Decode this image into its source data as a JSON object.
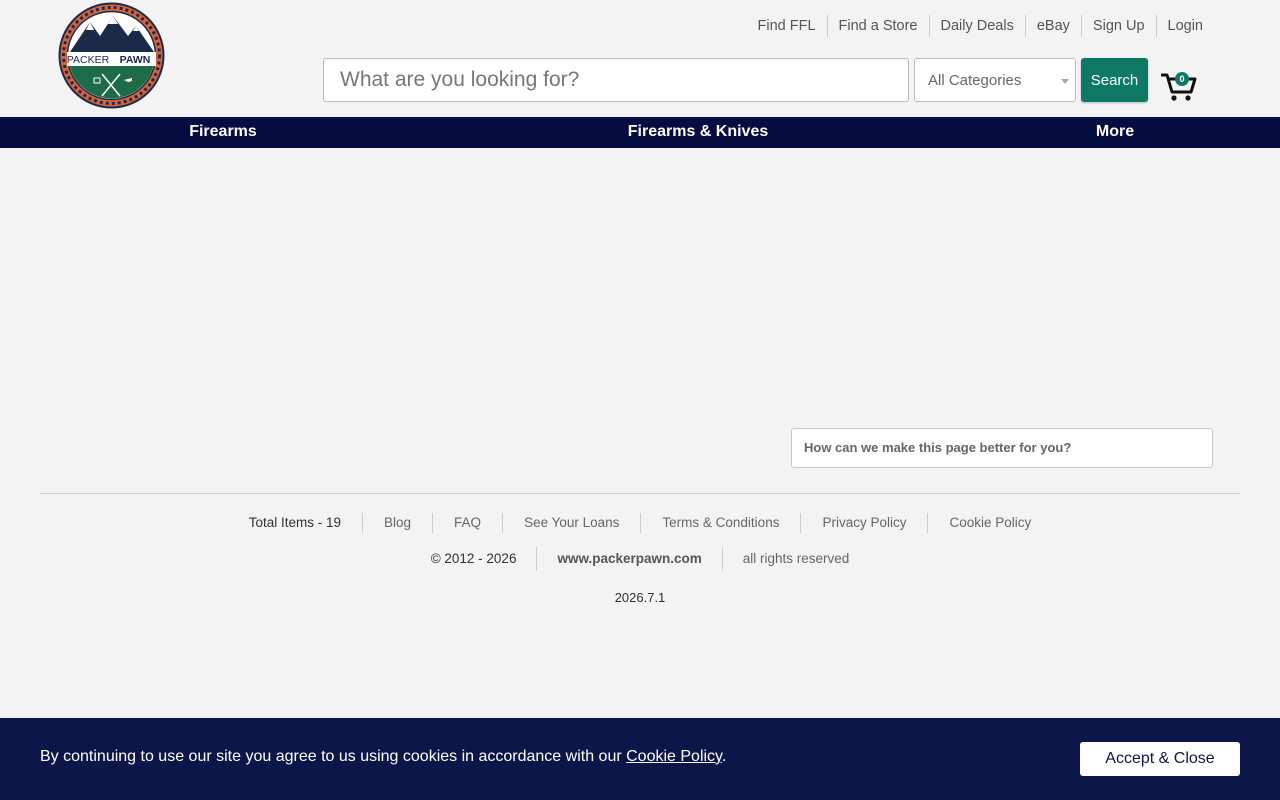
{
  "header": {
    "logo": {
      "line1": "PACKER",
      "line2": "PAWN"
    },
    "toplinks": [
      "Find FFL",
      "Find a Store",
      "Daily Deals",
      "eBay",
      "Sign Up",
      "Login"
    ],
    "search": {
      "placeholder": "What are you looking for?",
      "category": "All Categories",
      "button_label": "Search"
    },
    "cart_count": "0"
  },
  "nav": {
    "items": [
      "Firearms",
      "Firearms & Knives",
      "More"
    ]
  },
  "feedback": {
    "placeholder": "How can we make this page better for you?"
  },
  "footer": {
    "links": [
      "Total Items - 19",
      "Blog",
      "FAQ",
      "See Your Loans",
      "Terms & Conditions",
      "Privacy Policy",
      "Cookie Policy"
    ],
    "copyright": [
      "© 2012 - 2026",
      "www.packerpawn.com",
      "all rights reserved"
    ],
    "version": "2026.7.1"
  },
  "cookie": {
    "text_before": "By continuing to use our site you agree to us using cookies in accordance with our ",
    "link_text": "Cookie Policy",
    "text_after": ".",
    "accept_label": "Accept & Close"
  },
  "colors": {
    "nav_bg": "#050c40",
    "accent": "#0e7a66",
    "banner_bg": "#0d1648",
    "logo_navy": "#1c2a4a",
    "logo_green": "#1d6b47",
    "logo_orange": "#d8653a"
  }
}
